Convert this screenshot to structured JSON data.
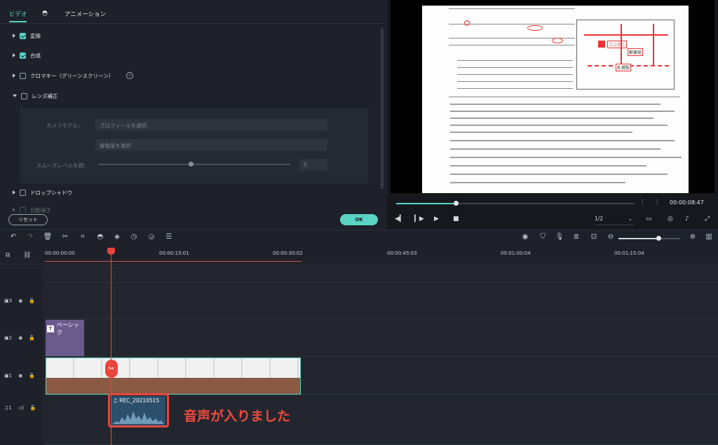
{
  "left_panel": {
    "tabs": [
      "ビデオ",
      "カラー",
      "アニメーション"
    ],
    "tab_color_icon": "palette-icon",
    "items": [
      {
        "label": "変換",
        "checked": true,
        "expanded": false
      },
      {
        "label": "合成",
        "checked": true,
        "expanded": false
      },
      {
        "label": "クロマキー（グリーンスクリーン）",
        "checked": false,
        "expanded": false
      },
      {
        "label": "レンズ補正",
        "checked": false,
        "expanded": true
      },
      {
        "label": "ドロップシャドウ",
        "checked": false,
        "expanded": false
      },
      {
        "label": "自動補正",
        "checked": false,
        "expanded": false
      }
    ],
    "help_glyph": "?",
    "lens": {
      "camera_model_label": "カメラモデル：",
      "profile_placeholder": "プロフィールを選択",
      "resolution_placeholder": "解像度を選択",
      "smooth_label": "スムーズレベルを調:",
      "smooth_value": "0",
      "smooth_level": 0.5
    },
    "reset_label": "リセット",
    "ok_label": "OK"
  },
  "preview": {
    "timecode": "00:00:08:47",
    "progress": 0.25,
    "zoom": "1/2",
    "bracket_left": "{",
    "bracket_right": "}",
    "map_labels": {
      "conv": "コンビニ",
      "post": "郵便局",
      "station": "札幌駅"
    }
  },
  "ruler": {
    "ticks": [
      "00:00:00:00",
      "00:00:15:01",
      "00:00:30:02",
      "00:00:45:03",
      "00:01:00:04",
      "00:01:15:04"
    ]
  },
  "tracks": [
    {
      "id": "3",
      "type": "video"
    },
    {
      "id": "2",
      "type": "video"
    },
    {
      "id": "1",
      "type": "video"
    },
    {
      "id": "1",
      "type": "audio"
    }
  ],
  "clips": {
    "title": "ベーシック",
    "audio": "REC_20210515"
  },
  "annotation": "音声が入りました",
  "colors": {
    "accent": "#59d3c2",
    "playhead": "#e8453c",
    "annotation": "#f04a3e"
  }
}
